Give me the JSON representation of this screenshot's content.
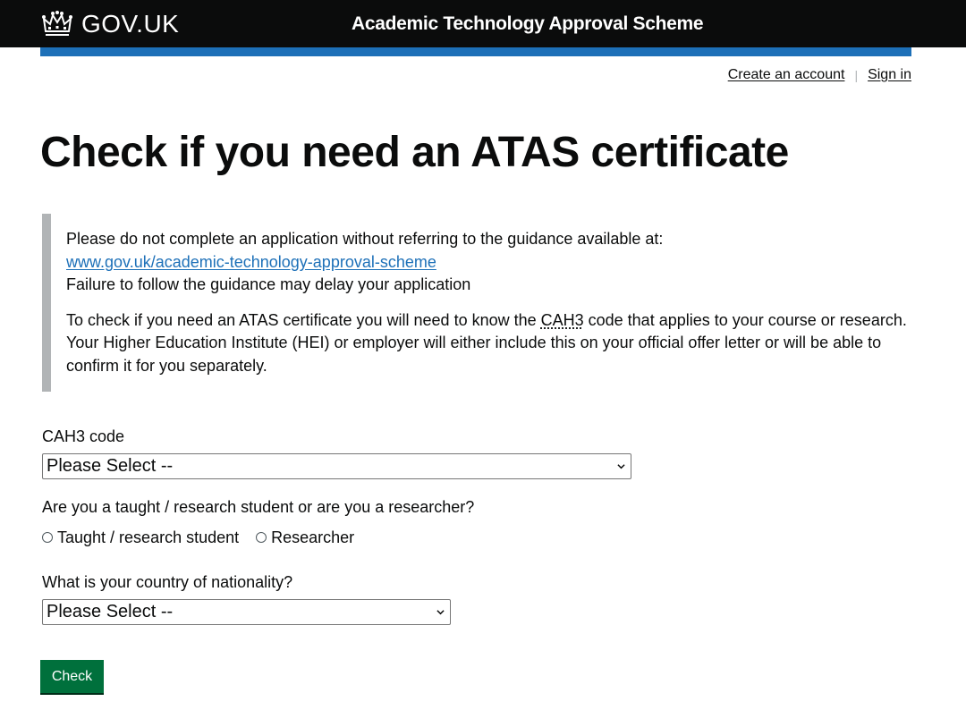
{
  "header": {
    "logo_text": "GOV.UK",
    "service_name": "Academic Technology Approval Scheme",
    "accent_color": "#1d70b8"
  },
  "account": {
    "create_account": "Create an account",
    "separator": "|",
    "sign_in": "Sign in"
  },
  "page_title": "Check if you need an ATAS certificate",
  "inset": {
    "line1": "Please do not complete an application without referring to the guidance available at:",
    "link": "www.gov.uk/academic-technology-approval-scheme",
    "line2": "Failure to follow the guidance may delay your application",
    "para2_prefix": "To check if you need an ATAS certificate you will need to know the ",
    "para2_abbr": "CAH3",
    "para2_suffix": " code that applies to your course or research. Your Higher Education Institute (HEI) or employer will either include this on your official offer letter or will be able to confirm it for you separately."
  },
  "form": {
    "cah3_label": "CAH3 code",
    "cah3_value": "Please Select --",
    "role_question": "Are you a taught / research student or are you a researcher?",
    "role_options": [
      "Taught / research student",
      "Researcher"
    ],
    "nationality_label": "What is your country of nationality?",
    "nationality_value": "Please Select --",
    "submit_label": "Check",
    "button_color": "#00703c"
  }
}
